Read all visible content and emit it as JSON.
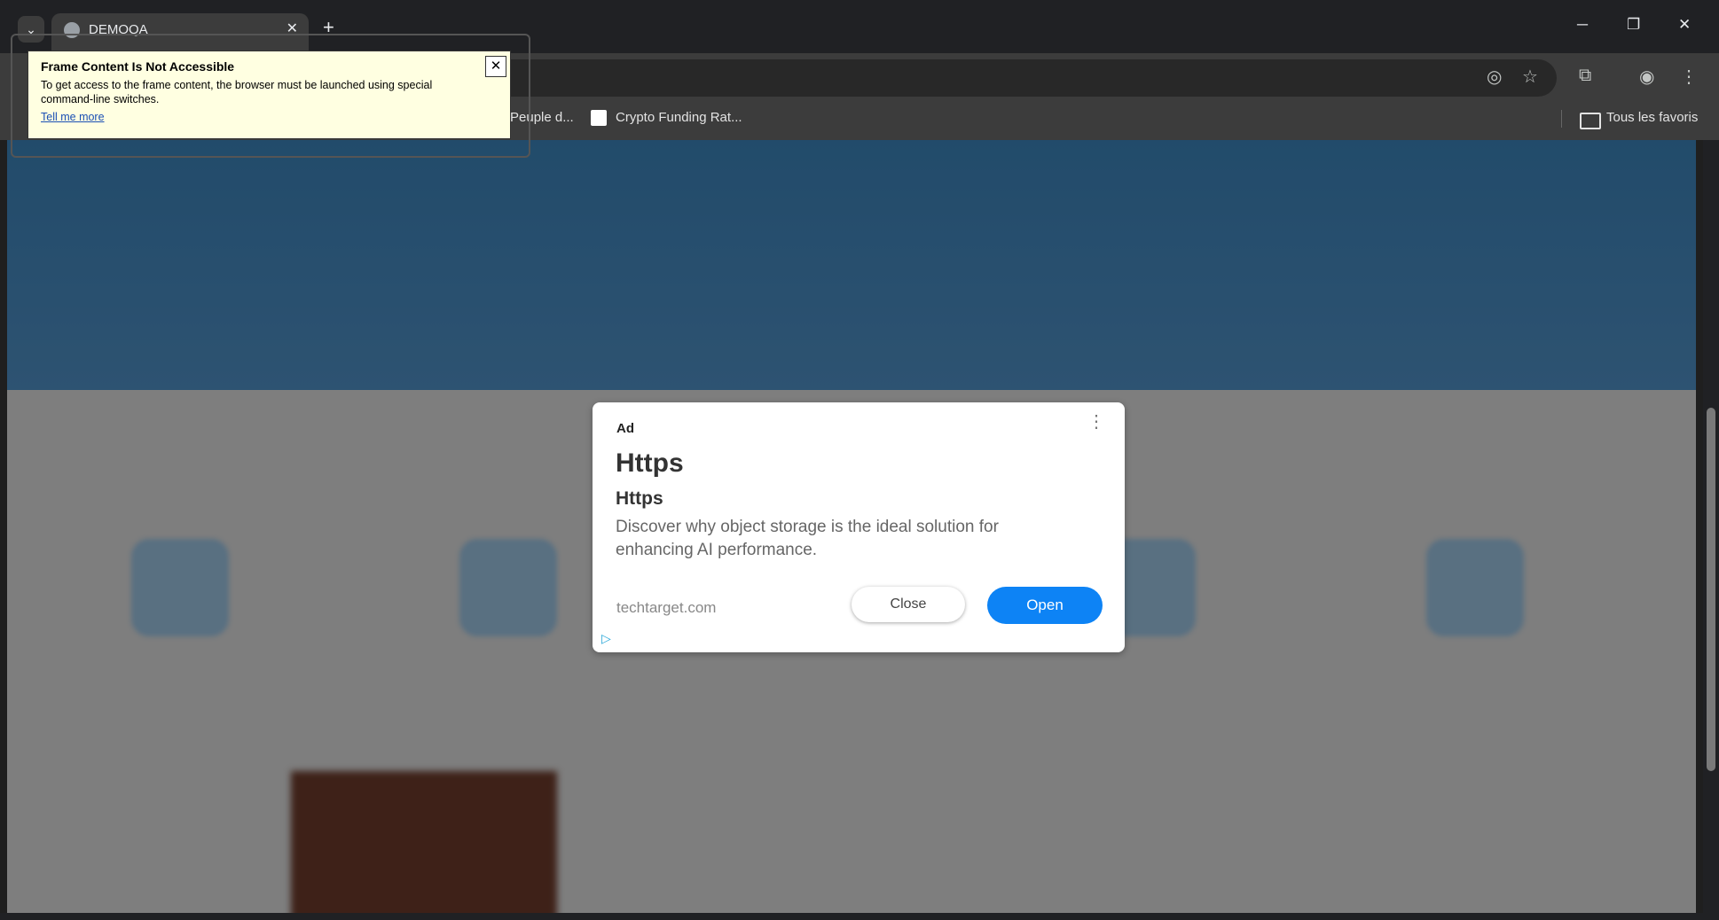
{
  "browser": {
    "tab_title": "DEMOQA",
    "tab_close": "✕",
    "new_tab": "+",
    "tab_search": "⌄",
    "window_controls": {
      "minimize": "─",
      "restore": "❐",
      "close": "✕"
    },
    "toolbar_icons": {
      "eye_off": "◎",
      "star": "☆",
      "extensions": "⧉",
      "profile": "◉",
      "menu": "⋮"
    }
  },
  "bookmarks": {
    "items": [
      {
        "label": "Peuple d..."
      },
      {
        "label": "Crypto Funding Rat..."
      }
    ],
    "all_bookmarks": "Tous les favoris"
  },
  "tooltip": {
    "title": "Frame Content Is Not Accessible",
    "body": "To get access to the frame content, the browser must be launched using special command-line switches.",
    "link": "Tell me more",
    "close": "✕"
  },
  "ad": {
    "label": "Ad",
    "menu": "⋮",
    "headline": "Https",
    "subheadline": "Https",
    "description": "Discover why object storage is the ideal solution for enhancing AI performance.",
    "domain": "techtarget.com",
    "close_label": "Close",
    "open_label": "Open",
    "adchoices": "▷"
  }
}
